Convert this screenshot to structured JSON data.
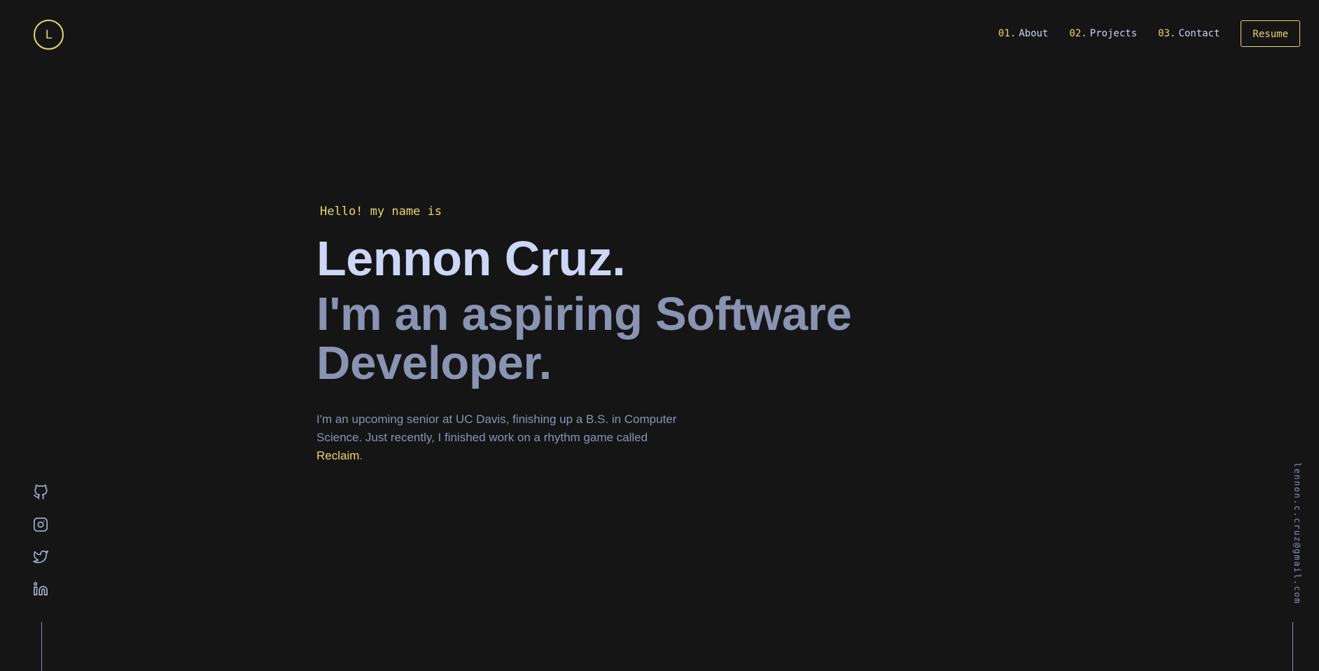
{
  "header": {
    "logo_letter": "L",
    "nav": [
      {
        "num": "01.",
        "label": "About"
      },
      {
        "num": "02.",
        "label": "Projects"
      },
      {
        "num": "03.",
        "label": "Contact"
      }
    ],
    "resume_label": "Resume"
  },
  "hero": {
    "greeting": "Hello! my name is",
    "name": "Lennon Cruz.",
    "tagline": "I'm an aspiring Software Developer.",
    "intro_text": "I'm an upcoming senior at UC Davis, finishing up a B.S. in Computer Science. Just recently, I finished work on a rhythm game called ",
    "intro_link": "Reclaim",
    "intro_end": "."
  },
  "socials": [
    {
      "icon": "github-icon"
    },
    {
      "icon": "instagram-icon"
    },
    {
      "icon": "twitter-icon"
    },
    {
      "icon": "linkedin-icon"
    }
  ],
  "email": "lennon.c.cruz@gmail.com",
  "colors": {
    "background": "#151516",
    "accent": "#e8d86e",
    "heading": "#cdd6f5",
    "text": "#8a93b2"
  }
}
